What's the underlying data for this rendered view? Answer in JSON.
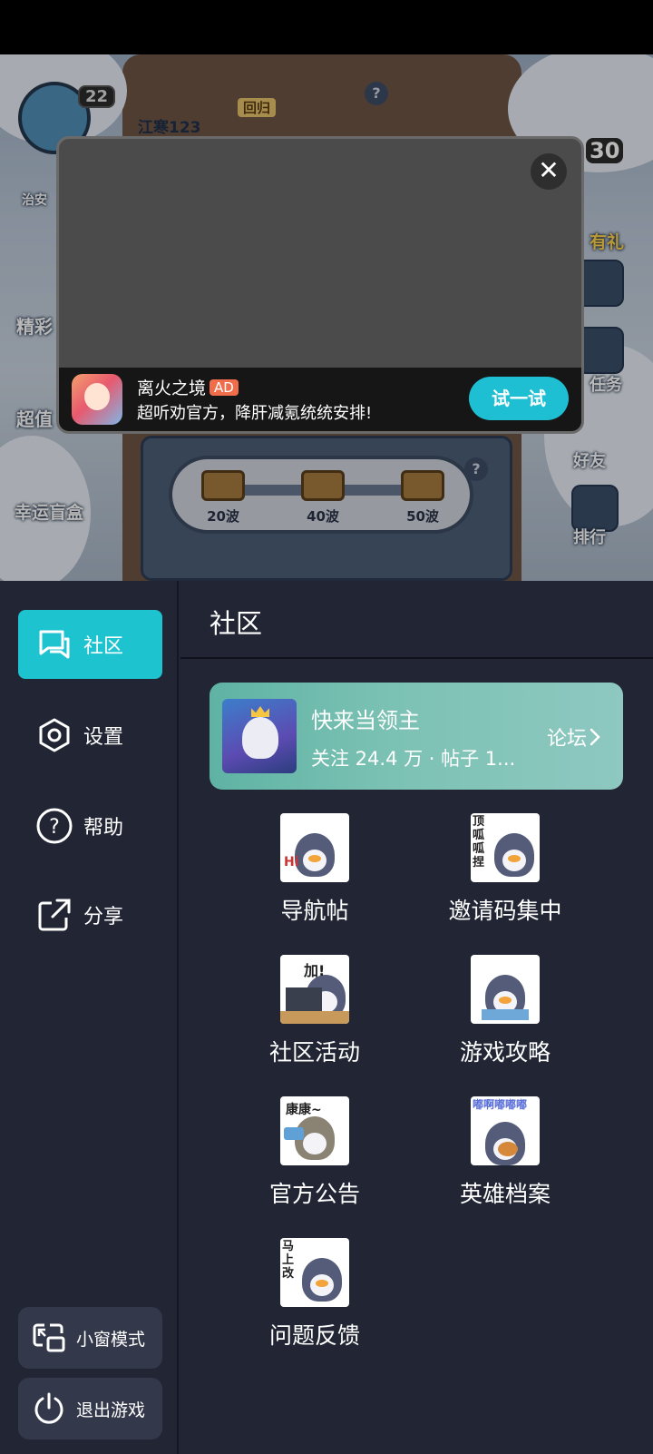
{
  "game": {
    "level": "22",
    "player_name": "江寒123",
    "return_label": "回归",
    "level_right": "30",
    "left_labels": [
      "治安",
      "精彩",
      "超值",
      "幸运盲盒"
    ],
    "right_labels": [
      "有礼",
      "任务",
      "好友",
      "排行"
    ],
    "waves": [
      "20波",
      "40波",
      "50波"
    ]
  },
  "ad": {
    "app_name": "离火之境",
    "ad_tag": "AD",
    "description": "超听劝官方，降肝减氪统统安排!",
    "cta": "试一试",
    "close_icon": "close-icon"
  },
  "sidebar": {
    "items": [
      {
        "label": "社区",
        "icon": "chat-icon"
      },
      {
        "label": "设置",
        "icon": "gear-icon"
      },
      {
        "label": "帮助",
        "icon": "help-icon"
      },
      {
        "label": "分享",
        "icon": "share-icon"
      }
    ],
    "pip_mode": "小窗模式",
    "exit_game": "退出游戏"
  },
  "main": {
    "title": "社区",
    "forum": {
      "title": "快来当领主",
      "stats": "关注 24.4 万 · 帖子 1...",
      "link": "论坛"
    },
    "items": [
      {
        "label": "导航帖",
        "sticker": "Hi"
      },
      {
        "label": "邀请码集中",
        "sticker": "顶呱呱捏"
      },
      {
        "label": "社区活动",
        "sticker": "加!"
      },
      {
        "label": "游戏攻略",
        "sticker": ""
      },
      {
        "label": "官方公告",
        "sticker": "康康~"
      },
      {
        "label": "英雄档案",
        "sticker": "嘟啊嘟嘟嘟"
      },
      {
        "label": "问题反馈",
        "sticker": "马上改"
      }
    ]
  },
  "colors": {
    "accent": "#1dc3cf",
    "panel_bg": "#222634",
    "ad_tag": "#f06d4c"
  }
}
